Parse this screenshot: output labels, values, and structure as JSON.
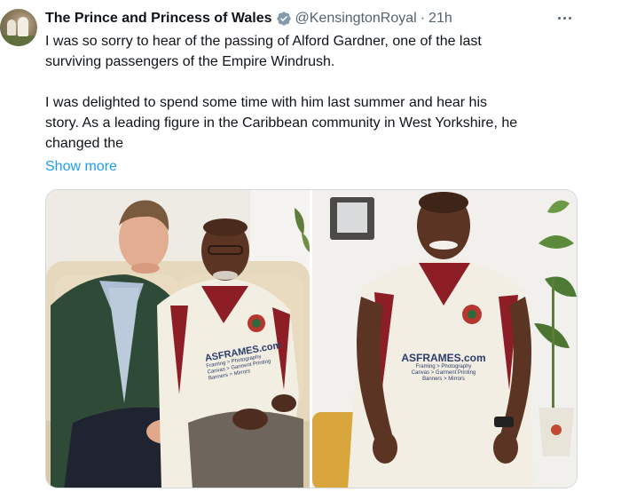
{
  "tweet": {
    "author_name": "The Prince and Princess of Wales",
    "handle": "@KensingtonRoyal",
    "separator": "·",
    "time": "21h",
    "paragraph1_line1": "I was so sorry to hear of the passing of Alford Gardner, one of the last",
    "paragraph1_line2": "surviving passengers of the Empire Windrush.",
    "paragraph2_line1": "I was delighted to spend some time with him last summer and hear his",
    "paragraph2_line2": "story. As a leading figure in the Caribbean community in West Yorkshire, he",
    "paragraph2_line3": "changed the",
    "show_more": "Show more"
  },
  "media": {
    "shirt_brand": "ASFRAMES.com",
    "shirt_line1": "Framing > Photography",
    "shirt_line2": "Canvas > Garment Printing",
    "shirt_line3": "Banners > Mirrors"
  },
  "colors": {
    "accent": "#1d9bf0",
    "muted": "#536471",
    "text": "#0f1419",
    "verified_badge": "#829aab"
  },
  "icons": {
    "verified": "verified-badge-icon",
    "more": "more-options-icon"
  }
}
